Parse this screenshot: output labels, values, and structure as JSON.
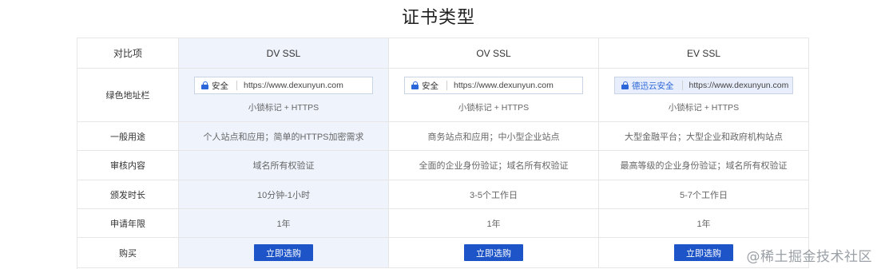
{
  "title": "证书类型",
  "header": {
    "label": "对比项",
    "columns": [
      "DV SSL",
      "OV SSL",
      "EV SSL"
    ]
  },
  "address_row": {
    "label": "绿色地址栏",
    "bars": [
      {
        "security": "安全",
        "url": "https://www.dexunyun.com",
        "caption": "小锁标记 + HTTPS"
      },
      {
        "security": "安全",
        "url": "https://www.dexunyun.com",
        "caption": "小锁标记 + HTTPS"
      },
      {
        "security": "德迅云安全",
        "url": "https://www.dexunyun.com",
        "caption": "小锁标记 + HTTPS"
      }
    ]
  },
  "rows": [
    {
      "label": "一般用途",
      "values": [
        "个人站点和应用；简单的HTTPS加密需求",
        "商务站点和应用；中小型企业站点",
        "大型金融平台；大型企业和政府机构站点"
      ]
    },
    {
      "label": "审核内容",
      "values": [
        "域名所有权验证",
        "全面的企业身份验证；域名所有权验证",
        "最高等级的企业身份验证；域名所有权验证"
      ]
    },
    {
      "label": "颁发时长",
      "values": [
        "10分钟-1小时",
        "3-5个工作日",
        "5-7个工作日"
      ]
    },
    {
      "label": "申请年限",
      "values": [
        "1年",
        "1年",
        "1年"
      ]
    }
  ],
  "buy_row": {
    "label": "购买",
    "button": "立即选购"
  },
  "watermark": "@稀土掘金技术社区",
  "colors": {
    "accent": "#1d54c8",
    "highlight": "#eef3fc"
  }
}
